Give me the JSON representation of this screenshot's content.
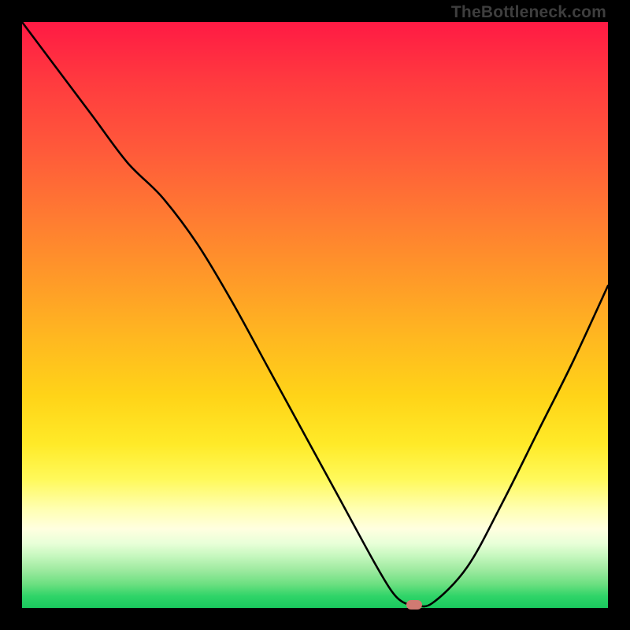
{
  "watermark": "TheBottleneck.com",
  "colors": {
    "frame": "#000000",
    "curve": "#000000",
    "marker": "#d07a72"
  },
  "chart_data": {
    "type": "line",
    "title": "",
    "xlabel": "",
    "ylabel": "",
    "xlim": [
      0,
      100
    ],
    "ylim": [
      0,
      100
    ],
    "x": [
      0,
      6,
      12,
      18,
      24,
      30,
      36,
      42,
      48,
      54,
      60,
      63,
      65,
      67,
      70,
      76,
      82,
      88,
      94,
      100
    ],
    "y": [
      100,
      92,
      84,
      76,
      70,
      62,
      52,
      41,
      30,
      19,
      8,
      3,
      1,
      0.6,
      0.8,
      7,
      18,
      30,
      42,
      55
    ],
    "series": [
      {
        "name": "bottleneck-curve",
        "x": [
          0,
          6,
          12,
          18,
          24,
          30,
          36,
          42,
          48,
          54,
          60,
          63,
          65,
          67,
          70,
          76,
          82,
          88,
          94,
          100
        ],
        "y": [
          100,
          92,
          84,
          76,
          70,
          62,
          52,
          41,
          30,
          19,
          8,
          3,
          1,
          0.6,
          0.8,
          7,
          18,
          30,
          42,
          55
        ]
      }
    ],
    "optimal_marker": {
      "x": 67,
      "y": 0.6
    },
    "annotations": []
  }
}
